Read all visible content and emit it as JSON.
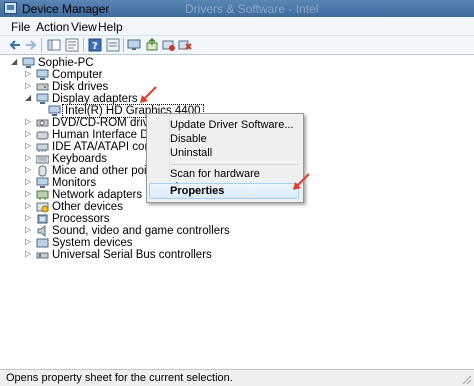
{
  "window": {
    "title": "Device Manager",
    "ghost_title": "Drivers & Software - Intel"
  },
  "menu": [
    "File",
    "Action",
    "View",
    "Help"
  ],
  "toolbar_icons": [
    "back-arrow-icon",
    "forward-arrow-icon",
    "tree-view-icon",
    "properties-icon",
    "help-icon",
    "view-icon",
    "monitor-icon",
    "update-driver-icon",
    "disable-icon",
    "uninstall-icon"
  ],
  "tree": {
    "root": "Sophie-PC",
    "items": [
      "Computer",
      "Disk drives",
      "Display adapters",
      "Intel(R) HD Graphics 4400",
      "DVD/CD-ROM drives",
      "Human Interface Devices",
      "IDE ATA/ATAPI controllers",
      "Keyboards",
      "Mice and other pointing de",
      "Monitors",
      "Network adapters",
      "Other devices",
      "Processors",
      "Sound, video and game controllers",
      "System devices",
      "Universal Serial Bus controllers"
    ]
  },
  "context_menu": {
    "update": "Update Driver Software...",
    "disable": "Disable",
    "uninstall": "Uninstall",
    "scan": "Scan for hardware changes",
    "properties": "Properties"
  },
  "status": "Opens property sheet for the current selection.",
  "colors": {
    "arrow": "#e0402b",
    "titlebar": "#3d6a9c",
    "highlight_border": "#a8d0f5"
  }
}
